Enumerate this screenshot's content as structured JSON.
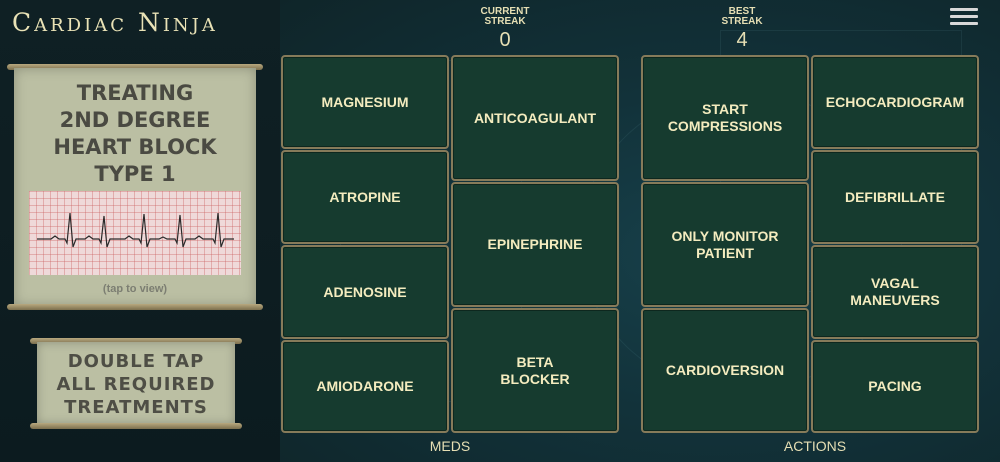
{
  "app": {
    "title": "Cardiac Ninja"
  },
  "header": {
    "current_streak": {
      "label": "CURRENT\nSTREAK",
      "value": "0"
    },
    "best_streak": {
      "label": "BEST\nSTREAK",
      "value": "4"
    },
    "menu_icon": "hamburger-menu-icon"
  },
  "scenario": {
    "title": "TREATING\n2ND DEGREE\nHEART BLOCK\nTYPE 1",
    "tap_hint": "(tap to view)",
    "instruction": "DOUBLE TAP\nALL REQUIRED\nTREATMENTS"
  },
  "meds": {
    "label": "MEDS",
    "col1": [
      "MAGNESIUM",
      "ATROPINE",
      "ADENOSINE",
      "AMIODARONE"
    ],
    "col2": [
      "ANTICOAGULANT",
      "EPINEPHRINE",
      "BETA\nBLOCKER"
    ]
  },
  "actions": {
    "label": "ACTIONS",
    "col1": [
      "START\nCOMPRESSIONS",
      "ONLY MONITOR\nPATIENT",
      "CARDIOVERSION"
    ],
    "col2": [
      "ECHOCARDIOGRAM",
      "DEFIBRILLATE",
      "VAGAL\nMANEUVERS",
      "PACING"
    ]
  },
  "colors": {
    "button_bg": "#163b2f",
    "button_border": "#867b5a",
    "card_bg": "#bbbfa3",
    "text_cream": "#f4ecbf"
  }
}
